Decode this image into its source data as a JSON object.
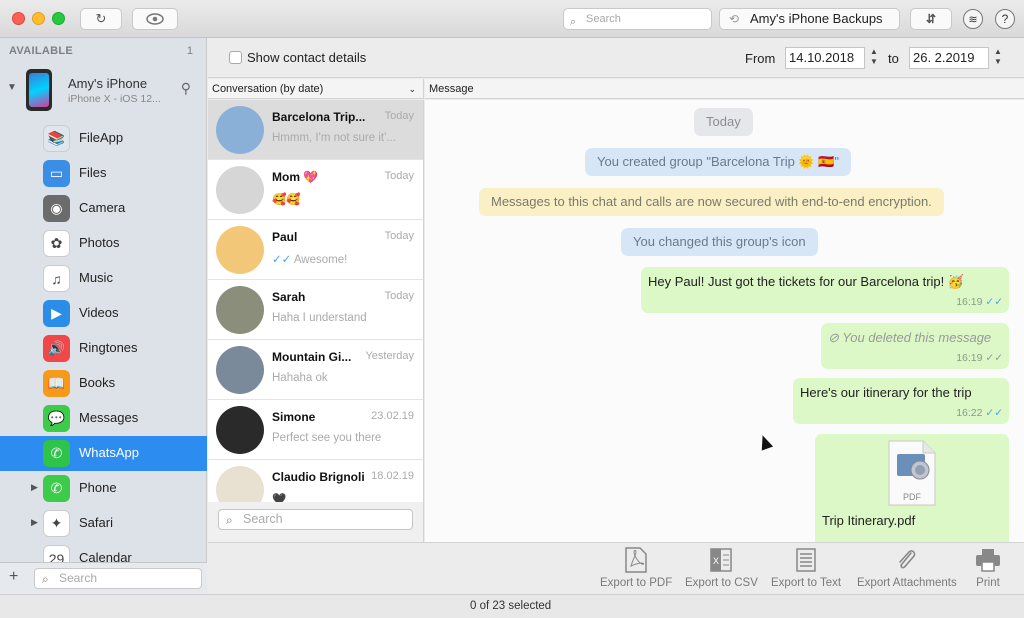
{
  "titlebar": {
    "search_placeholder": "Search",
    "backups_label": "Amy's iPhone Backups",
    "help_label": "?"
  },
  "sidebar": {
    "header": "AVAILABLE",
    "count": "1",
    "device": {
      "name": "Amy's iPhone",
      "subtitle": "iPhone X - iOS 12..."
    },
    "items": [
      {
        "label": "FileApp",
        "icon": "fileapp-icon",
        "color": "#dfe6ee"
      },
      {
        "label": "Files",
        "icon": "files-icon",
        "color": "#3a8ee6"
      },
      {
        "label": "Camera",
        "icon": "camera-icon",
        "color": "#6b6b6b"
      },
      {
        "label": "Photos",
        "icon": "photos-icon",
        "color": "#ffffff"
      },
      {
        "label": "Music",
        "icon": "music-icon",
        "color": "#ffffff"
      },
      {
        "label": "Videos",
        "icon": "videos-icon",
        "color": "#2a8ee8"
      },
      {
        "label": "Ringtones",
        "icon": "ringtones-icon",
        "color": "#f04848"
      },
      {
        "label": "Books",
        "icon": "books-icon",
        "color": "#f59a1a"
      },
      {
        "label": "Messages",
        "icon": "messages-icon",
        "color": "#3ccb4b"
      },
      {
        "label": "WhatsApp",
        "icon": "whatsapp-icon",
        "color": "#2ec44a"
      },
      {
        "label": "Phone",
        "icon": "phone-icon",
        "color": "#3ccb4b"
      },
      {
        "label": "Safari",
        "icon": "safari-icon",
        "color": "#ffffff"
      },
      {
        "label": "Calendar",
        "icon": "calendar-icon",
        "color": "#ffffff"
      }
    ],
    "selected_index": 9,
    "search_placeholder": "Search"
  },
  "filters": {
    "show_contact_details": "Show contact details",
    "from_label": "From",
    "from_date": "14.10.2018",
    "to_label": "to",
    "to_date": "26.  2.2019"
  },
  "columns": {
    "conversation": "Conversation (by date)",
    "message": "Message"
  },
  "conversations": [
    {
      "name": "Barcelona Trip...",
      "date": "Today",
      "preview": "Hmmm, I'm not sure it'...",
      "avatar_color": "#8ab0d8"
    },
    {
      "name": "Mom 💖",
      "date": "Today",
      "preview": "🥰🥰",
      "avatar_color": "#d6d6d6"
    },
    {
      "name": "Paul",
      "date": "Today",
      "preview": "Awesome!",
      "read": true,
      "avatar_color": "#f2c878"
    },
    {
      "name": "Sarah",
      "date": "Today",
      "preview": "Haha I understand",
      "avatar_color": "#8a8e7a"
    },
    {
      "name": "Mountain Gi...",
      "date": "Yesterday",
      "preview": "Hahaha ok",
      "avatar_color": "#7a8a9a"
    },
    {
      "name": "Simone",
      "date": "23.02.19",
      "preview": "Perfect see you there",
      "avatar_color": "#2a2a2a"
    },
    {
      "name": "Claudio Brignoli",
      "date": "18.02.19",
      "preview": "🖤",
      "avatar_color": "#e8e0d0"
    }
  ],
  "conv_search_placeholder": "Search",
  "messages": {
    "day": "Today",
    "created": "You created group \"Barcelona Trip 🌞 🇪🇸\"",
    "encryption": "Messages to this chat and calls are now secured with end-to-end encryption.",
    "icon_changed": "You changed this group's icon",
    "bubbles": [
      {
        "text": "Hey Paul! Just got the tickets for our Barcelona trip! 🥳",
        "time": "16:19"
      },
      {
        "text": "⊘ You deleted this message",
        "time": "16:19"
      },
      {
        "text": "Here's our itinerary for the trip",
        "time": "16:22"
      }
    ],
    "attachment": {
      "file_type": "PDF",
      "file_name": "Trip Itinerary.pdf"
    }
  },
  "toolbar": {
    "export_pdf": "Export to PDF",
    "export_csv": "Export to CSV",
    "export_text": "Export to Text",
    "export_attachments": "Export Attachments",
    "print": "Print"
  },
  "status": "0 of 23 selected",
  "colors": {
    "accent": "#2d8cf0",
    "bubble": "#dcf8c6",
    "read_tick": "#4aa3e8"
  }
}
